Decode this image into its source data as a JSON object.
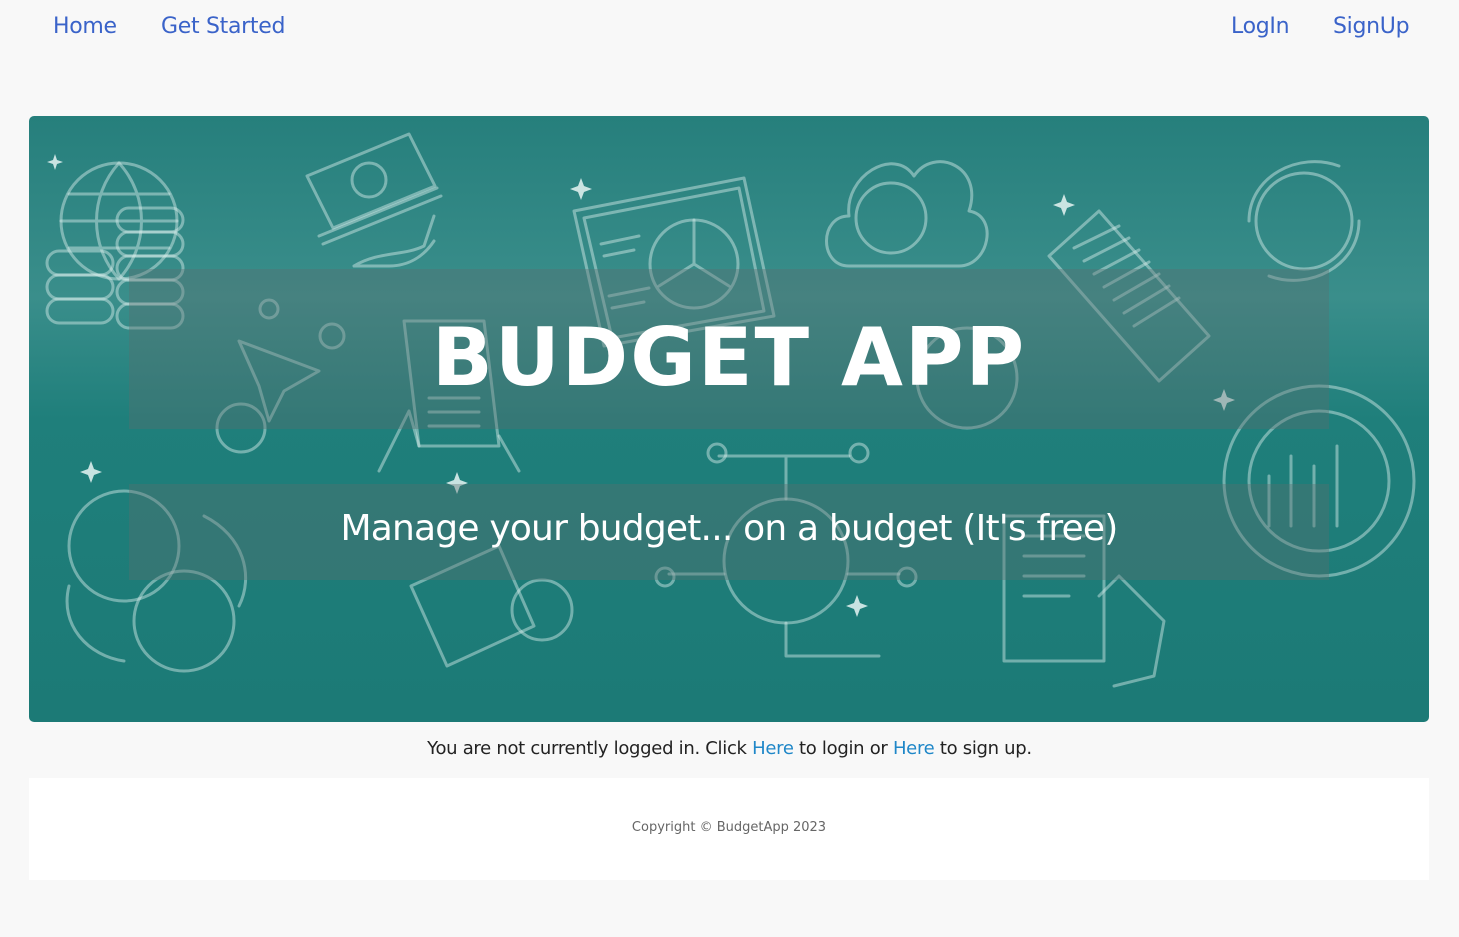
{
  "nav": {
    "home": "Home",
    "get_started": "Get Started",
    "login": "LogIn",
    "signup": "SignUp"
  },
  "hero": {
    "title": "BUDGET APP",
    "subtitle": "Manage your budget... on a budget (It's free)"
  },
  "notice": {
    "prefix": "You are not currently logged in. Click ",
    "login_link": "Here",
    "middle": " to login or ",
    "signup_link": "Here",
    "suffix": " to sign up."
  },
  "footer": {
    "copyright": "Copyright © BudgetApp 2023"
  },
  "colors": {
    "nav_link": "#3a63c9",
    "hero_teal": "#267f7c",
    "link": "#1f87c8"
  }
}
